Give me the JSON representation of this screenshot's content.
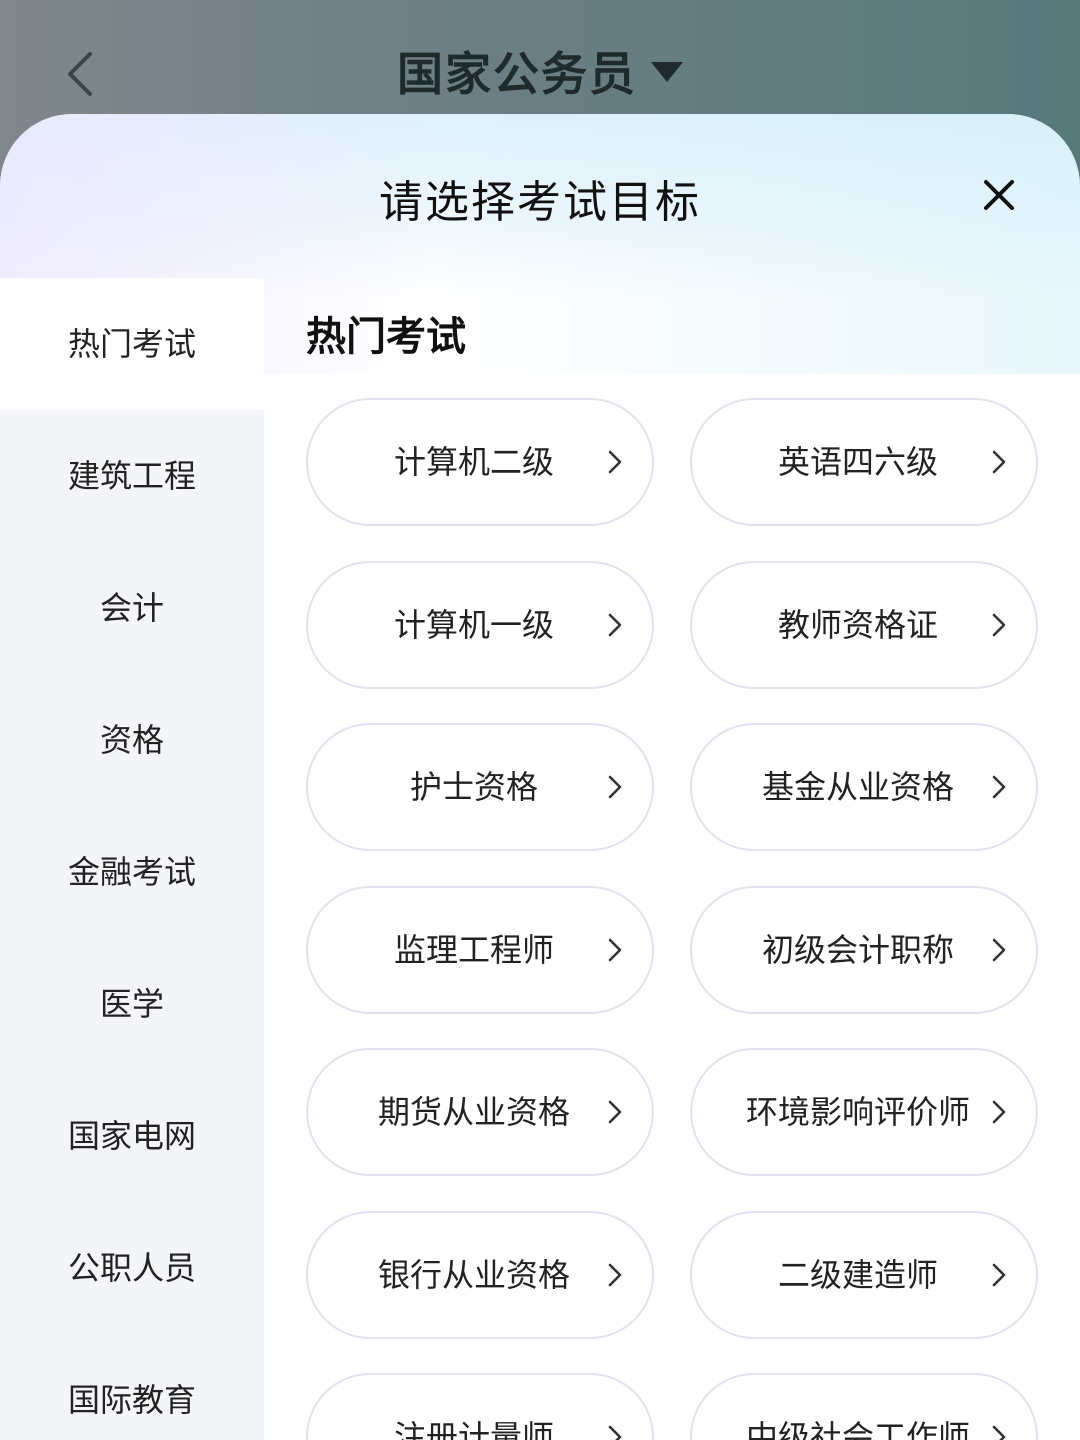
{
  "header": {
    "title": "国家公务员"
  },
  "sheet": {
    "title": "请选择考试目标"
  },
  "sidebar": {
    "items": [
      {
        "label": "热门考试",
        "active": true
      },
      {
        "label": "建筑工程",
        "active": false
      },
      {
        "label": "会计",
        "active": false
      },
      {
        "label": "资格",
        "active": false
      },
      {
        "label": "金融考试",
        "active": false
      },
      {
        "label": "医学",
        "active": false
      },
      {
        "label": "国家电网",
        "active": false
      },
      {
        "label": "公职人员",
        "active": false
      },
      {
        "label": "国际教育",
        "active": false
      }
    ]
  },
  "main": {
    "section_title": "热门考试",
    "exams": [
      "计算机二级",
      "英语四六级",
      "计算机一级",
      "教师资格证",
      "护士资格",
      "基金从业资格",
      "监理工程师",
      "初级会计职称",
      "期货从业资格",
      "环境影响评价师",
      "银行从业资格",
      "二级建造师",
      "注册计量师",
      "中级社会工作师"
    ]
  },
  "colors": {
    "header_bg": "#6c7e84",
    "sidebar_bg": "#f4f5f9",
    "pill_border": "#dfe3ee",
    "text": "#222222"
  },
  "icons": {
    "back": "chevron-left-icon",
    "title_caret": "caret-down-icon",
    "close": "close-icon",
    "pill_arrow": "chevron-right-icon"
  }
}
